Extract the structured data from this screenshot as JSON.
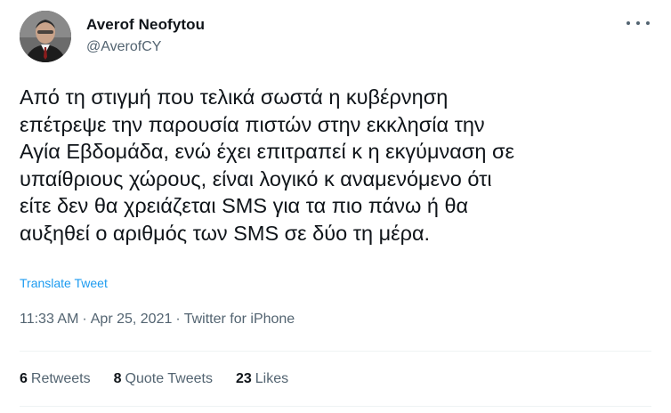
{
  "author": {
    "name": "Averof Neofytou",
    "handle": "@AverofCY"
  },
  "icons": {
    "more": "more-horizontal-icon",
    "avatar": "profile-photo"
  },
  "tweet": {
    "text": "Από τη στιγμή που τελικά σωστά η κυβέρνηση\nεπέτρεψε την παρουσία πιστών στην εκκλησία την\nΑγία Εβδομάδα, ενώ έχει επιτραπεί κ η εκγύμναση σε\nυπαίθριους χώρους, είναι λογικό κ αναμενόμενο ότι\nείτε δεν θα χρειάζεται SMS για τα πιο πάνω ή θα\nαυξηθεί ο αριθμός των SMS σε δύο τη μέρα.",
    "translate_label": "Translate Tweet",
    "time": "11:33 AM",
    "date": "Apr 25, 2021",
    "source": "Twitter for iPhone",
    "separator": "·"
  },
  "stats": {
    "retweets_count": "6",
    "retweets_label": "Retweets",
    "quote_count": "8",
    "quote_label": "Quote Tweets",
    "likes_count": "23",
    "likes_label": "Likes"
  },
  "colors": {
    "text": "#0f1419",
    "secondary": "#536471",
    "link": "#1d9bf0",
    "divider": "#eff3f4"
  }
}
